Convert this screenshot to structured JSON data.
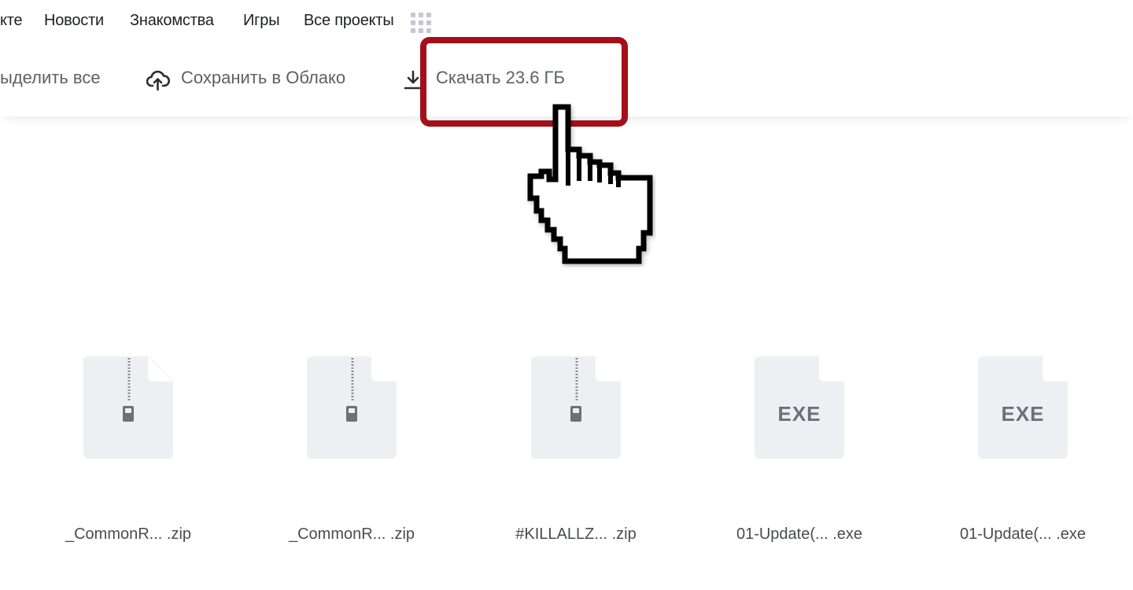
{
  "nav": {
    "items": [
      {
        "label": "кте"
      },
      {
        "label": "Новости"
      },
      {
        "label": "Знакомства"
      },
      {
        "label": "Игры"
      },
      {
        "label": "Все проекты"
      }
    ],
    "apps_icon": "grid-icon"
  },
  "toolbar": {
    "select_all": "ыделить все",
    "save_cloud": "Сохранить в Облако",
    "download": "Скачать 23.6 ГБ",
    "cloud_icon": "cloud-upload-icon",
    "download_icon": "download-icon",
    "highlight_color": "#a4101a"
  },
  "files": [
    {
      "name": "_CommonR...  .zip",
      "type": "zip",
      "badge": ""
    },
    {
      "name": "_CommonR...  .zip",
      "type": "zip",
      "badge": ""
    },
    {
      "name": "#KILLALLZ...  .zip",
      "type": "zip",
      "badge": ""
    },
    {
      "name": "01-Update(... .exe",
      "type": "exe",
      "badge": "EXE"
    },
    {
      "name": "01-Update(... .exe",
      "type": "exe",
      "badge": "EXE"
    }
  ],
  "cursor_icon": "hand-pointer-icon"
}
